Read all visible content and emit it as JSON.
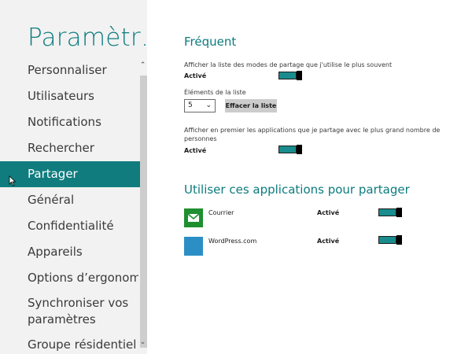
{
  "sidebar": {
    "title": "Paramètr…",
    "items": [
      {
        "label": "Personnaliser"
      },
      {
        "label": "Utilisateurs"
      },
      {
        "label": "Notifications"
      },
      {
        "label": "Rechercher"
      },
      {
        "label": "Partager"
      },
      {
        "label": "Général"
      },
      {
        "label": "Confidentialité"
      },
      {
        "label": "Appareils"
      },
      {
        "label": "Options d’ergonomie"
      },
      {
        "label": "Synchroniser vos paramètres"
      },
      {
        "label": "Groupe résidentiel"
      }
    ],
    "selected_index": 4
  },
  "frequent": {
    "title": "Fréquent",
    "show_modes": {
      "description": "Afficher la liste des modes de partage que j'utilise le plus souvent",
      "state": "Activé"
    },
    "list_items": {
      "label": "Éléments de la liste",
      "value": "5",
      "clear_label": "Effacer la liste"
    },
    "show_apps_first": {
      "description": "Afficher en premier les applications que je partage avec le plus grand nombre de personnes",
      "state": "Activé"
    }
  },
  "share_apps": {
    "title": "Utiliser ces applications pour partager",
    "apps": [
      {
        "name": "Courrier",
        "state": "Activé",
        "icon": "mail-icon",
        "color": "#1f8f2f"
      },
      {
        "name": "WordPress.com",
        "state": "Activé",
        "icon": "wordpress-icon",
        "color": "#2b8fc6"
      }
    ]
  },
  "colors": {
    "accent": "#0c7b7e",
    "selected_bg": "#107c7e",
    "toggle_on": "#1a8c8e"
  }
}
